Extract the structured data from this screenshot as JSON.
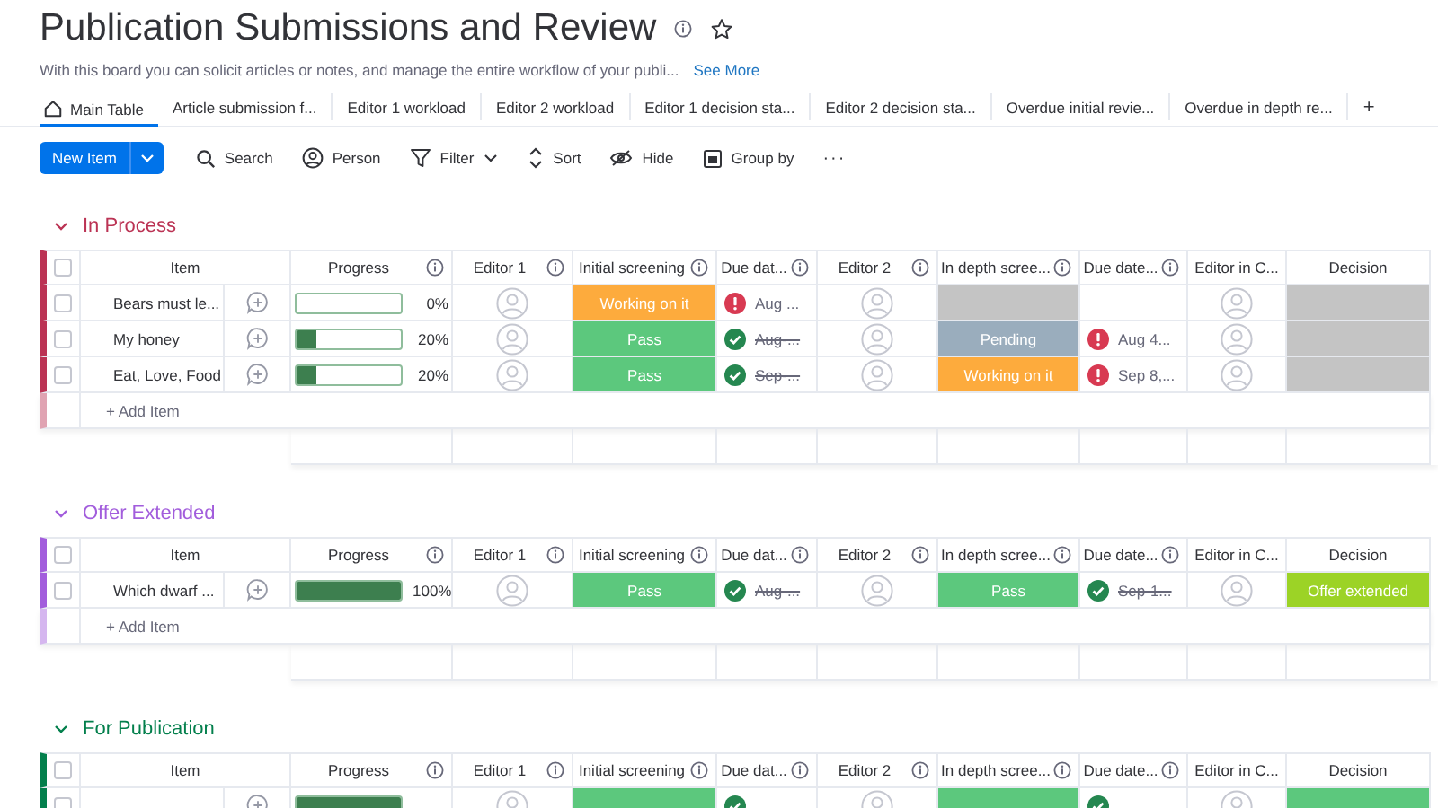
{
  "board": {
    "title": "Publication Submissions and Review",
    "description": "With this board you can solicit articles or notes, and manage the entire workflow of your publi...",
    "see_more": "See More"
  },
  "tabs": [
    {
      "label": "Main Table",
      "selected": true
    },
    {
      "label": "Article submission f...",
      "selected": false
    },
    {
      "label": "Editor 1 workload",
      "selected": false
    },
    {
      "label": "Editor 2 workload",
      "selected": false
    },
    {
      "label": "Editor 1 decision sta...",
      "selected": false
    },
    {
      "label": "Editor 2 decision sta...",
      "selected": false
    },
    {
      "label": "Overdue initial revie...",
      "selected": false
    },
    {
      "label": "Overdue in depth re...",
      "selected": false
    }
  ],
  "add_view": "+",
  "toolbar": {
    "new_item": "New Item",
    "actions": [
      {
        "kind": "search",
        "label": "Search"
      },
      {
        "kind": "person",
        "label": "Person"
      },
      {
        "kind": "filter",
        "label": "Filter"
      },
      {
        "kind": "sort",
        "label": "Sort"
      },
      {
        "kind": "hide",
        "label": "Hide"
      },
      {
        "kind": "group",
        "label": "Group by"
      }
    ],
    "more": "···"
  },
  "groups": [
    {
      "name": "In Process",
      "color": "#bb3354",
      "all_checked": false,
      "add_item": "+ Add Item",
      "columns": [
        {
          "label": "Item",
          "info": false
        },
        {
          "label": "Progress",
          "info": true
        },
        {
          "label": "Editor 1",
          "info": true
        },
        {
          "label": "Initial screening",
          "info": true
        },
        {
          "label": "Due dat...",
          "info": true
        },
        {
          "label": "Editor 2",
          "info": true
        },
        {
          "label": "In depth scree...",
          "info": true
        },
        {
          "label": "Due date...",
          "info": true
        },
        {
          "label": "Editor in C...",
          "info": false
        },
        {
          "label": "Decision",
          "info": false
        }
      ],
      "rows": [
        {
          "checked": false,
          "item": "Bears must le...",
          "progress": {
            "level": 0,
            "reading": "0%"
          },
          "initial": {
            "label": "Working on it",
            "color": "#fdab3d"
          },
          "due1": {
            "kind": "overdue",
            "text": "Aug ..."
          },
          "in_depth": {
            "color": "#c4c4c4"
          },
          "due2": {},
          "decision": {
            "color": "#c4c4c4"
          }
        },
        {
          "checked": false,
          "item": "My honey",
          "progress": {
            "level": 0.2,
            "reading": "20%"
          },
          "initial": {
            "label": "Pass",
            "color": "#5cc87d"
          },
          "due1": {
            "kind": "done",
            "text": "Aug-..."
          },
          "in_depth": {
            "label": "Pending",
            "color": "#9aadbd"
          },
          "due2": {
            "kind": "overdue",
            "text": "Aug 4..."
          },
          "decision": {
            "color": "#c4c4c4"
          }
        },
        {
          "checked": false,
          "item": "Eat, Love, Food",
          "progress": {
            "level": 0.2,
            "reading": "20%"
          },
          "initial": {
            "label": "Pass",
            "color": "#5cc87d"
          },
          "due1": {
            "kind": "done",
            "text": "Sep-..."
          },
          "in_depth": {
            "label": "Working on it",
            "color": "#fdab3d"
          },
          "due2": {
            "kind": "overdue",
            "text": "Sep 8,..."
          },
          "decision": {
            "color": "#c4c4c4"
          }
        }
      ]
    },
    {
      "name": "Offer Extended",
      "color": "#a25ddc",
      "all_checked": false,
      "add_item": "+ Add Item",
      "columns": [
        {
          "label": "Item",
          "info": false
        },
        {
          "label": "Progress",
          "info": true
        },
        {
          "label": "Editor 1",
          "info": true
        },
        {
          "label": "Initial screening",
          "info": true
        },
        {
          "label": "Due dat...",
          "info": true
        },
        {
          "label": "Editor 2",
          "info": true
        },
        {
          "label": "In depth scree...",
          "info": true
        },
        {
          "label": "Due date...",
          "info": true
        },
        {
          "label": "Editor in C...",
          "info": false
        },
        {
          "label": "Decision",
          "info": false
        }
      ],
      "rows": [
        {
          "checked": false,
          "item": "Which dwarf ...",
          "progress": {
            "level": 1,
            "reading": "100%"
          },
          "initial": {
            "label": "Pass",
            "color": "#5cc87d"
          },
          "due1": {
            "kind": "done",
            "text": "Aug-..."
          },
          "in_depth": {
            "label": "Pass",
            "color": "#5cc87d"
          },
          "due2": {
            "kind": "done",
            "text": "Sep-1..."
          },
          "decision": {
            "label": "Offer extended",
            "color": "#9cd326"
          }
        }
      ]
    },
    {
      "name": "For Publication",
      "color": "#037f4c",
      "all_checked": false,
      "columns": [
        {
          "label": "Item",
          "info": false
        },
        {
          "label": "Progress",
          "info": true
        },
        {
          "label": "Editor 1",
          "info": true
        },
        {
          "label": "Initial screening",
          "info": true
        },
        {
          "label": "Due dat...",
          "info": true
        },
        {
          "label": "Editor 2",
          "info": true
        },
        {
          "label": "In depth scree...",
          "info": true
        },
        {
          "label": "Due date...",
          "info": true
        },
        {
          "label": "Editor in C...",
          "info": false
        },
        {
          "label": "Decision",
          "info": false
        }
      ],
      "rows": [
        {
          "checked": false,
          "progress": {
            "level": 1
          },
          "initial": {
            "color": "#5cc87d"
          },
          "due1": {
            "kind": "done"
          },
          "in_depth": {
            "color": "#5cc87d"
          },
          "due2": {
            "kind": "done"
          },
          "decision": {
            "color": "#5cc87d"
          }
        }
      ]
    }
  ]
}
